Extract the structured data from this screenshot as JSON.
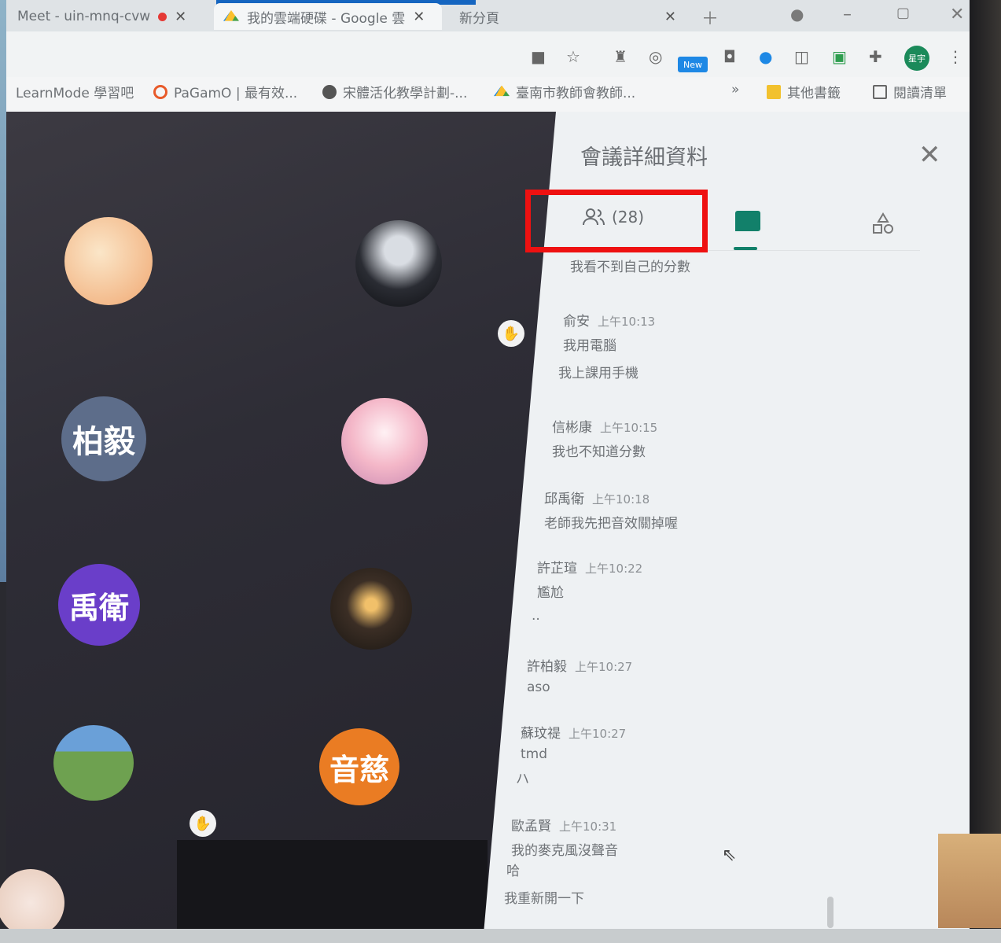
{
  "tabs": [
    {
      "label": "Meet - uin-mnq-cvw",
      "active": false
    },
    {
      "label": "我的雲端硬碟 - Google 雲",
      "active": true
    },
    {
      "label": "新分頁",
      "active": false
    }
  ],
  "bookmarks": [
    {
      "label": "LearnMode 學習吧"
    },
    {
      "label": "PaGamO | 最有效..."
    },
    {
      "label": "宋體活化教學計劃-..."
    },
    {
      "label": "臺南市教師會教師..."
    },
    {
      "label": "其他書籤"
    },
    {
      "label": "閱讀清單"
    }
  ],
  "toolbar": {
    "new_badge": "New",
    "profile_label": "星宇",
    "more_label": "»"
  },
  "participants": {
    "p1": {
      "label": "",
      "color": "#f4c9a0"
    },
    "p3": {
      "label": "柏毅",
      "color": "#5d6d8a"
    },
    "p5": {
      "label": "禹衛",
      "color": "#6a3ec9"
    },
    "p8": {
      "label": "音慈",
      "color": "#ea7c23"
    }
  },
  "panel": {
    "title": "會議詳細資料",
    "people_count": "(28)",
    "messages": [
      {
        "who": "",
        "time": "",
        "text": "我看不到自己的分數"
      },
      {
        "who": "俞安",
        "time": "上午10:13",
        "text": "我用電腦"
      },
      {
        "who": "",
        "time": "",
        "text": "我上課用手機"
      },
      {
        "who": "信彬康",
        "time": "上午10:15",
        "text": "我也不知道分數"
      },
      {
        "who": "邱禹衛",
        "time": "上午10:18",
        "text": "老師我先把音效關掉喔"
      },
      {
        "who": "許芷瑄",
        "time": "上午10:22",
        "text": "尷尬"
      },
      {
        "who": "",
        "time": "",
        "text": ".."
      },
      {
        "who": "許柏毅",
        "time": "上午10:27",
        "text": "aso"
      },
      {
        "who": "蘇玟禔",
        "time": "上午10:27",
        "text": "tmd"
      },
      {
        "who": "",
        "time": "",
        "text": "ハ"
      },
      {
        "who": "歐孟賢",
        "time": "上午10:31",
        "text": "我的麥克風沒聲音"
      },
      {
        "who": "",
        "time": "",
        "text": "哈"
      },
      {
        "who": "",
        "time": "",
        "text": "我重新開一下"
      }
    ]
  },
  "icons": {
    "close": "close-icon",
    "people": "people-icon",
    "chat": "chat-icon",
    "activities": "activities-icon",
    "hand": "raised-hand-icon"
  }
}
